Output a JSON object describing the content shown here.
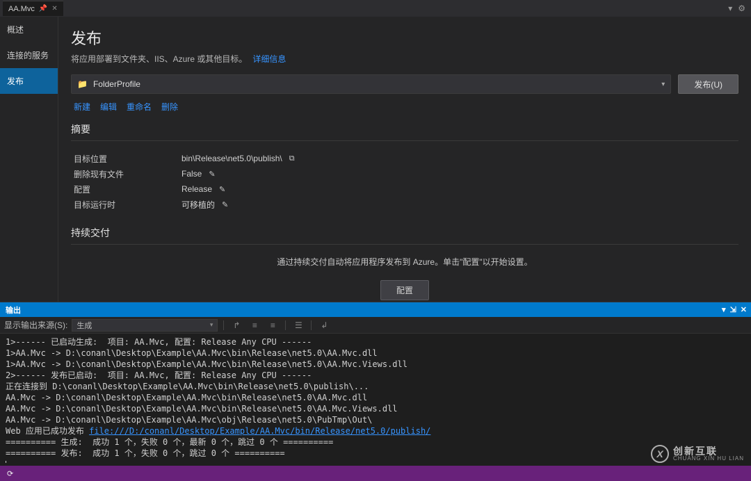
{
  "tabs": {
    "active": "AA.Mvc"
  },
  "sidenav": {
    "items": [
      {
        "label": "概述"
      },
      {
        "label": "连接的服务"
      },
      {
        "label": "发布"
      }
    ],
    "active_index": 2
  },
  "page": {
    "title": "发布",
    "subtitle": "将应用部署到文件夹、IIS、Azure 或其他目标。",
    "details_link": "详细信息"
  },
  "profile": {
    "selected": "FolderProfile",
    "publish_button": "发布(U)",
    "links": {
      "new": "新建",
      "edit": "编辑",
      "rename": "重命名",
      "delete": "删除"
    }
  },
  "summary": {
    "title": "摘要",
    "rows": {
      "target_location": {
        "label": "目标位置",
        "value": "bin\\Release\\net5.0\\publish\\"
      },
      "delete_existing": {
        "label": "删除现有文件",
        "value": "False"
      },
      "configuration": {
        "label": "配置",
        "value": "Release"
      },
      "target_runtime": {
        "label": "目标运行时",
        "value": "可移植的"
      }
    }
  },
  "ci": {
    "title": "持续交付",
    "desc": "通过持续交付自动将应用程序发布到 Azure。单击\"配置\"以开始设置。",
    "button": "配置"
  },
  "output": {
    "panel_title": "输出",
    "source_label": "显示输出来源(S):",
    "source_value": "生成",
    "lines": [
      "1>------ 已启动生成:  项目: AA.Mvc, 配置: Release Any CPU ------",
      "1>AA.Mvc -> D:\\conanl\\Desktop\\Example\\AA.Mvc\\bin\\Release\\net5.0\\AA.Mvc.dll",
      "1>AA.Mvc -> D:\\conanl\\Desktop\\Example\\AA.Mvc\\bin\\Release\\net5.0\\AA.Mvc.Views.dll",
      "2>------ 发布已启动:  项目: AA.Mvc, 配置: Release Any CPU ------",
      "正在连接到 D:\\conanl\\Desktop\\Example\\AA.Mvc\\bin\\Release\\net5.0\\publish\\...",
      "AA.Mvc -> D:\\conanl\\Desktop\\Example\\AA.Mvc\\bin\\Release\\net5.0\\AA.Mvc.dll",
      "AA.Mvc -> D:\\conanl\\Desktop\\Example\\AA.Mvc\\bin\\Release\\net5.0\\AA.Mvc.Views.dll",
      "AA.Mvc -> D:\\conanl\\Desktop\\Example\\AA.Mvc\\obj\\Release\\net5.0\\PubTmp\\Out\\",
      "Web 应用已成功发布 "
    ],
    "link": "file:///D:/conanl/Desktop/Example/AA.Mvc/bin/Release/net5.0/publish/",
    "summary1_prefix": "========== ",
    "summary1": "生成:  成功 1 个，失败 0 个，最新 0 个，跳过 0 个",
    "summary1_suffix": " ==========",
    "summary2_prefix": "========== ",
    "summary2": "发布:  成功 1 个，失败 0 个，跳过 0 个",
    "summary2_suffix": " =========="
  },
  "watermark": {
    "cn": "创新互联",
    "en": "CHUANG XIN HU LIAN"
  }
}
